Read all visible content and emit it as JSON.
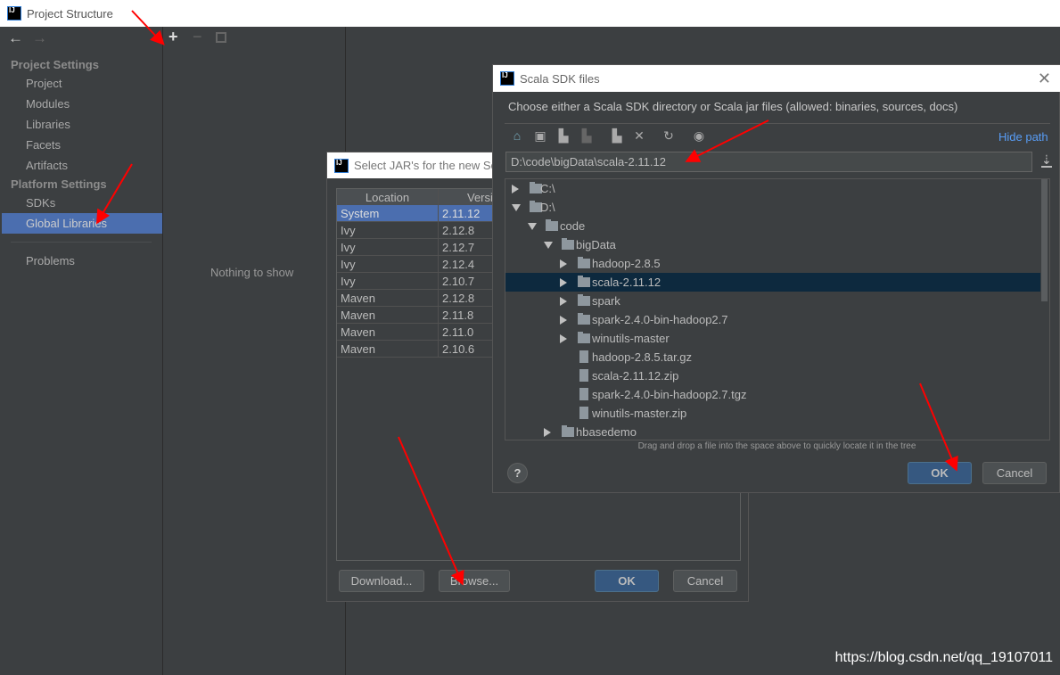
{
  "window": {
    "title": "Project Structure"
  },
  "toolbar": {
    "back": "←",
    "forward": "→",
    "add": "+",
    "remove": "−"
  },
  "sidebar": {
    "project_heading": "Project Settings",
    "project_items": [
      "Project",
      "Modules",
      "Libraries",
      "Facets",
      "Artifacts"
    ],
    "platform_heading": "Platform Settings",
    "platform_items": [
      "SDKs",
      "Global Libraries"
    ],
    "selected": "Global Libraries",
    "problems": "Problems"
  },
  "middle": {
    "empty_text": "Nothing to show"
  },
  "jar_dialog": {
    "title": "Select JAR's for the new Sca",
    "columns": [
      "Location",
      "Versi"
    ],
    "rows": [
      [
        "System",
        "2.11.12"
      ],
      [
        "Ivy",
        "2.12.8"
      ],
      [
        "Ivy",
        "2.12.7"
      ],
      [
        "Ivy",
        "2.12.4"
      ],
      [
        "Ivy",
        "2.10.7"
      ],
      [
        "Maven",
        "2.12.8"
      ],
      [
        "Maven",
        "2.11.8"
      ],
      [
        "Maven",
        "2.11.0"
      ],
      [
        "Maven",
        "2.10.6"
      ]
    ],
    "selected_row": 0,
    "buttons": {
      "download": "Download...",
      "browse": "Browse...",
      "ok": "OK",
      "cancel": "Cancel"
    }
  },
  "sdk_dialog": {
    "title": "Scala SDK files",
    "description": "Choose either a Scala SDK directory or Scala jar files (allowed: binaries, sources, docs)",
    "hide_path": "Hide path",
    "path_value": "D:\\code\\bigData\\scala-2.11.12",
    "tree": [
      {
        "label": "C:\\",
        "level": 0,
        "type": "drive",
        "expanded": false
      },
      {
        "label": "D:\\",
        "level": 0,
        "type": "drive",
        "expanded": true
      },
      {
        "label": "code",
        "level": 1,
        "type": "folder",
        "expanded": true
      },
      {
        "label": "bigData",
        "level": 2,
        "type": "folder",
        "expanded": true
      },
      {
        "label": "hadoop-2.8.5",
        "level": 3,
        "type": "folder",
        "expanded": false
      },
      {
        "label": "scala-2.11.12",
        "level": 3,
        "type": "folder",
        "expanded": false,
        "selected": true
      },
      {
        "label": "spark",
        "level": 3,
        "type": "folder",
        "expanded": false
      },
      {
        "label": "spark-2.4.0-bin-hadoop2.7",
        "level": 3,
        "type": "folder",
        "expanded": false
      },
      {
        "label": "winutils-master",
        "level": 3,
        "type": "folder",
        "expanded": false
      },
      {
        "label": "hadoop-2.8.5.tar.gz",
        "level": 3,
        "type": "unknown-file"
      },
      {
        "label": "scala-2.11.12.zip",
        "level": 3,
        "type": "archive"
      },
      {
        "label": "spark-2.4.0-bin-hadoop2.7.tgz",
        "level": 3,
        "type": "unknown-file"
      },
      {
        "label": "winutils-master.zip",
        "level": 3,
        "type": "archive"
      },
      {
        "label": "hbasedemo",
        "level": 2,
        "type": "folder",
        "expanded": false
      }
    ],
    "hint": "Drag and drop a file into the space above to quickly locate it in the tree",
    "help": "?",
    "ok": "OK",
    "cancel": "Cancel"
  },
  "watermark": "https://blog.csdn.net/qq_19107011",
  "colors": {
    "background": "#3c3f41",
    "selection": "#4b6eaf",
    "tree_selection": "#0d293e",
    "default_button": "#365880",
    "link": "#589df6",
    "annotation_arrow": "#ff0000"
  }
}
